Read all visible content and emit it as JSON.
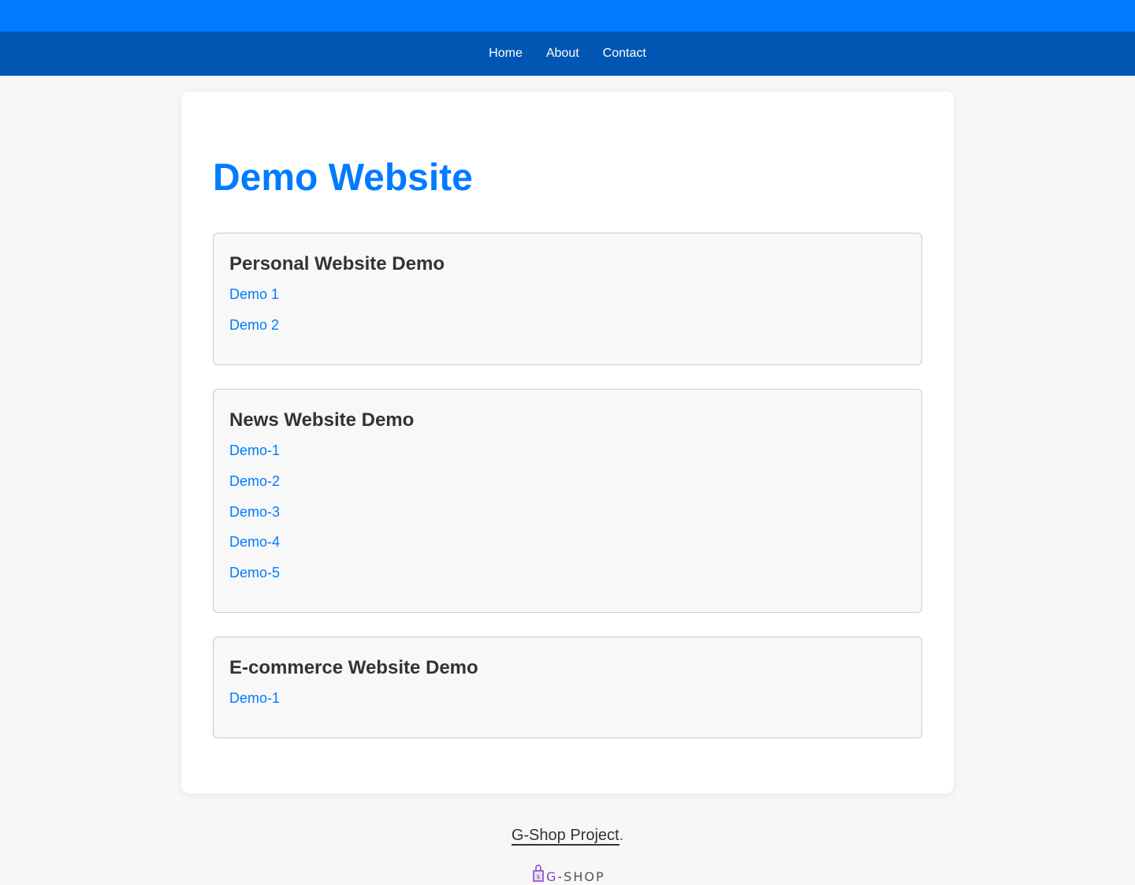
{
  "nav": {
    "items": [
      {
        "label": "Home"
      },
      {
        "label": "About"
      },
      {
        "label": "Contact"
      }
    ]
  },
  "main": {
    "title": "Demo Website",
    "sections": [
      {
        "title": "Personal Website Demo",
        "links": [
          "Demo 1",
          "Demo 2"
        ]
      },
      {
        "title": "News Website Demo",
        "links": [
          "Demo-1",
          "Demo-2",
          "Demo-3",
          "Demo-4",
          "Demo-5"
        ]
      },
      {
        "title": "E-commerce Website Demo",
        "links": [
          "Demo-1"
        ]
      }
    ]
  },
  "footer": {
    "link_label": "G-Shop Project",
    "suffix": ".",
    "logo": {
      "g": "G",
      "rest": "-SHOP",
      "icon": "shopping-bag-icon"
    }
  },
  "colors": {
    "top_bar": "#007bff",
    "nav_bar": "#0056b3",
    "accent": "#007bff",
    "logo_purple": "#8a3fbf"
  }
}
